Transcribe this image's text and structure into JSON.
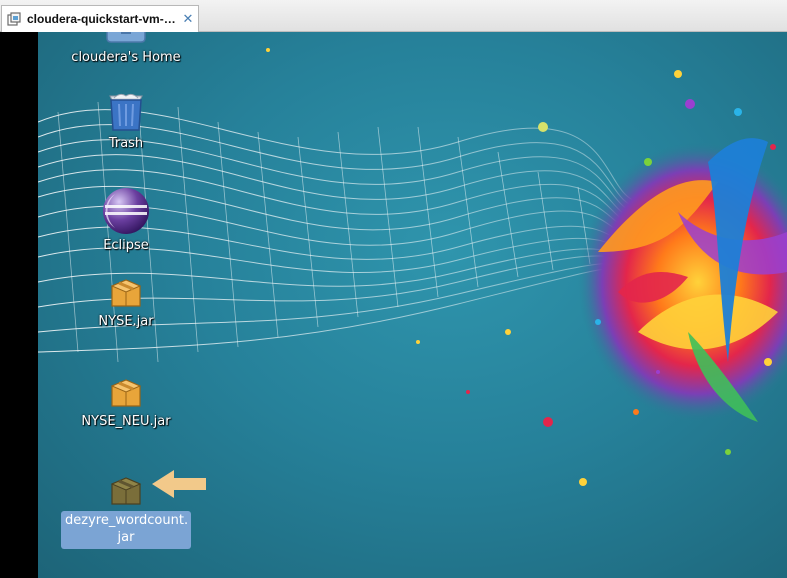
{
  "tab": {
    "title": "cloudera-quickstart-vm-4...",
    "icon": "vm-icon",
    "close_glyph": "✕"
  },
  "desktop": {
    "icons": [
      {
        "label": "cloudera's Home",
        "icon": "home-folder-icon"
      },
      {
        "label": "Trash",
        "icon": "trash-icon"
      },
      {
        "label": "Eclipse",
        "icon": "eclipse-icon"
      },
      {
        "label": "NYSE.jar",
        "icon": "jar-package-icon"
      },
      {
        "label": "NYSE_NEU.jar",
        "icon": "jar-package-icon"
      },
      {
        "label": "dezyre_wordcount.\njar",
        "icon": "jar-package-icon",
        "selected": true
      }
    ],
    "annotation": "arrow-left-icon"
  },
  "colors": {
    "desktop_bg": "#2a7b92",
    "selection": "#7ba4d4",
    "arrow": "#f2c98a",
    "tab_close": "#4a7fb3"
  }
}
